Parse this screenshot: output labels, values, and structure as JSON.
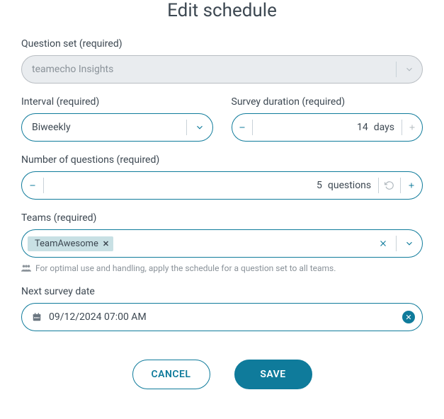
{
  "title": "Edit schedule",
  "questionSet": {
    "label": "Question set (required)",
    "value": "teamecho Insights"
  },
  "interval": {
    "label": "Interval (required)",
    "value": "Biweekly"
  },
  "duration": {
    "label": "Survey duration (required)",
    "value": "14",
    "unit": "days"
  },
  "numQuestions": {
    "label": "Number of questions (required)",
    "value": "5",
    "unit": "questions"
  },
  "teams": {
    "label": "Teams (required)",
    "chips": [
      {
        "name": "TeamAwesome"
      }
    ],
    "hint": "For optimal use and handling, apply the schedule for a question set to all teams."
  },
  "nextDate": {
    "label": "Next survey date",
    "value": "09/12/2024 07:00 AM"
  },
  "actions": {
    "cancel": "CANCEL",
    "save": "SAVE"
  }
}
